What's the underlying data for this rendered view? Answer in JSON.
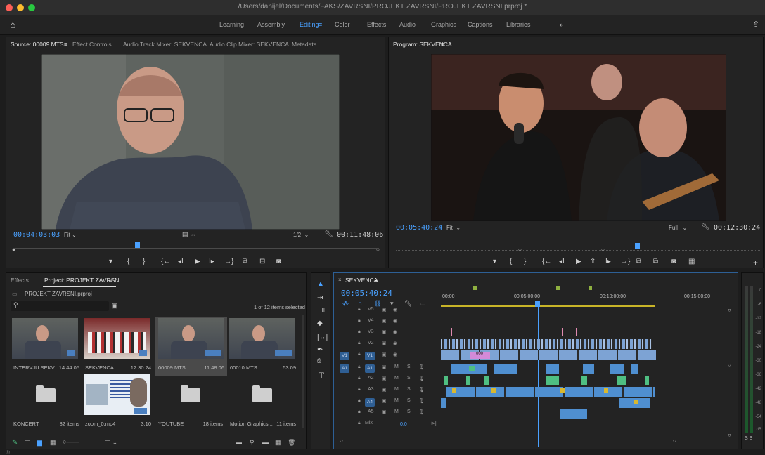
{
  "window": {
    "title": "/Users/danijel/Documents/FAKS/ZAVRSNI/PROJEKT ZAVRSNI/PROJEKT ZAVRSNI.prproj *"
  },
  "workspaces": [
    {
      "label": "Learning"
    },
    {
      "label": "Assembly"
    },
    {
      "label": "Editing"
    },
    {
      "label": "Color"
    },
    {
      "label": "Effects"
    },
    {
      "label": "Audio"
    },
    {
      "label": "Graphics"
    },
    {
      "label": "Captions"
    },
    {
      "label": "Libraries"
    }
  ],
  "workspace_overflow": "»",
  "source_panel": {
    "tabs": [
      "Source: 00009.MTS",
      "Effect Controls",
      "Audio Track Mixer: SEKVENCA",
      "Audio Clip Mixer: SEKVENCA",
      "Metadata"
    ],
    "timecode": "00:04:03:03",
    "fit": "Fit",
    "resolution": "1/2",
    "duration": "00:11:48:06"
  },
  "program_panel": {
    "tab": "Program: SEKVENCA",
    "timecode": "00:05:40:24",
    "fit": "Fit",
    "resolution": "Full",
    "duration": "00:12:30:24"
  },
  "project_panel": {
    "tabs": [
      "Effects",
      "Project: PROJEKT ZAVRSNI"
    ],
    "filename": "PROJEKT ZAVRSNI.prproj",
    "selection_count": "1 of 12 items selected",
    "items": [
      {
        "name": "INTERVJU SEKV...",
        "info": "14:44:05"
      },
      {
        "name": "SEKVENCA",
        "info": "12:30:24"
      },
      {
        "name": "00009.MTS",
        "info": "11:48:06"
      },
      {
        "name": "00010.MTS",
        "info": "53:09"
      },
      {
        "name": "KONCERT",
        "info": "82 items"
      },
      {
        "name": "zoom_0.mp4",
        "info": "3:10"
      },
      {
        "name": "YOUTUBE",
        "info": "18 items"
      },
      {
        "name": "Motion Graphics...",
        "info": "11 items"
      }
    ]
  },
  "timeline": {
    "tab": "SEKVENCA",
    "timecode": "00:05:40:24",
    "ruler": [
      "00:00",
      "00:05:00:00",
      "00:10:00:00",
      "00:15:00:00"
    ],
    "video_tracks": [
      "V5",
      "V4",
      "V3",
      "V2",
      "V1"
    ],
    "audio_tracks": [
      "A1",
      "A2",
      "A3",
      "A4",
      "A5"
    ],
    "mix_label": "Mix",
    "mix_value": "0,0",
    "src_v": "V1",
    "src_a": "A1",
    "clip_label": "000",
    "m_label": "M",
    "s_label": "S"
  },
  "meter": {
    "labels": [
      "0",
      "-6",
      "-12",
      "-18",
      "-24",
      "-30",
      "-36",
      "-42",
      "-48",
      "-54",
      "dB"
    ],
    "solo": "S S"
  },
  "colors": {
    "accent": "#4aa1ff",
    "video_clip": "#7da3d4",
    "audio_clip": "#4f8fd0",
    "green_clip": "#4fbf82",
    "playhead": "#4aa1ff"
  }
}
